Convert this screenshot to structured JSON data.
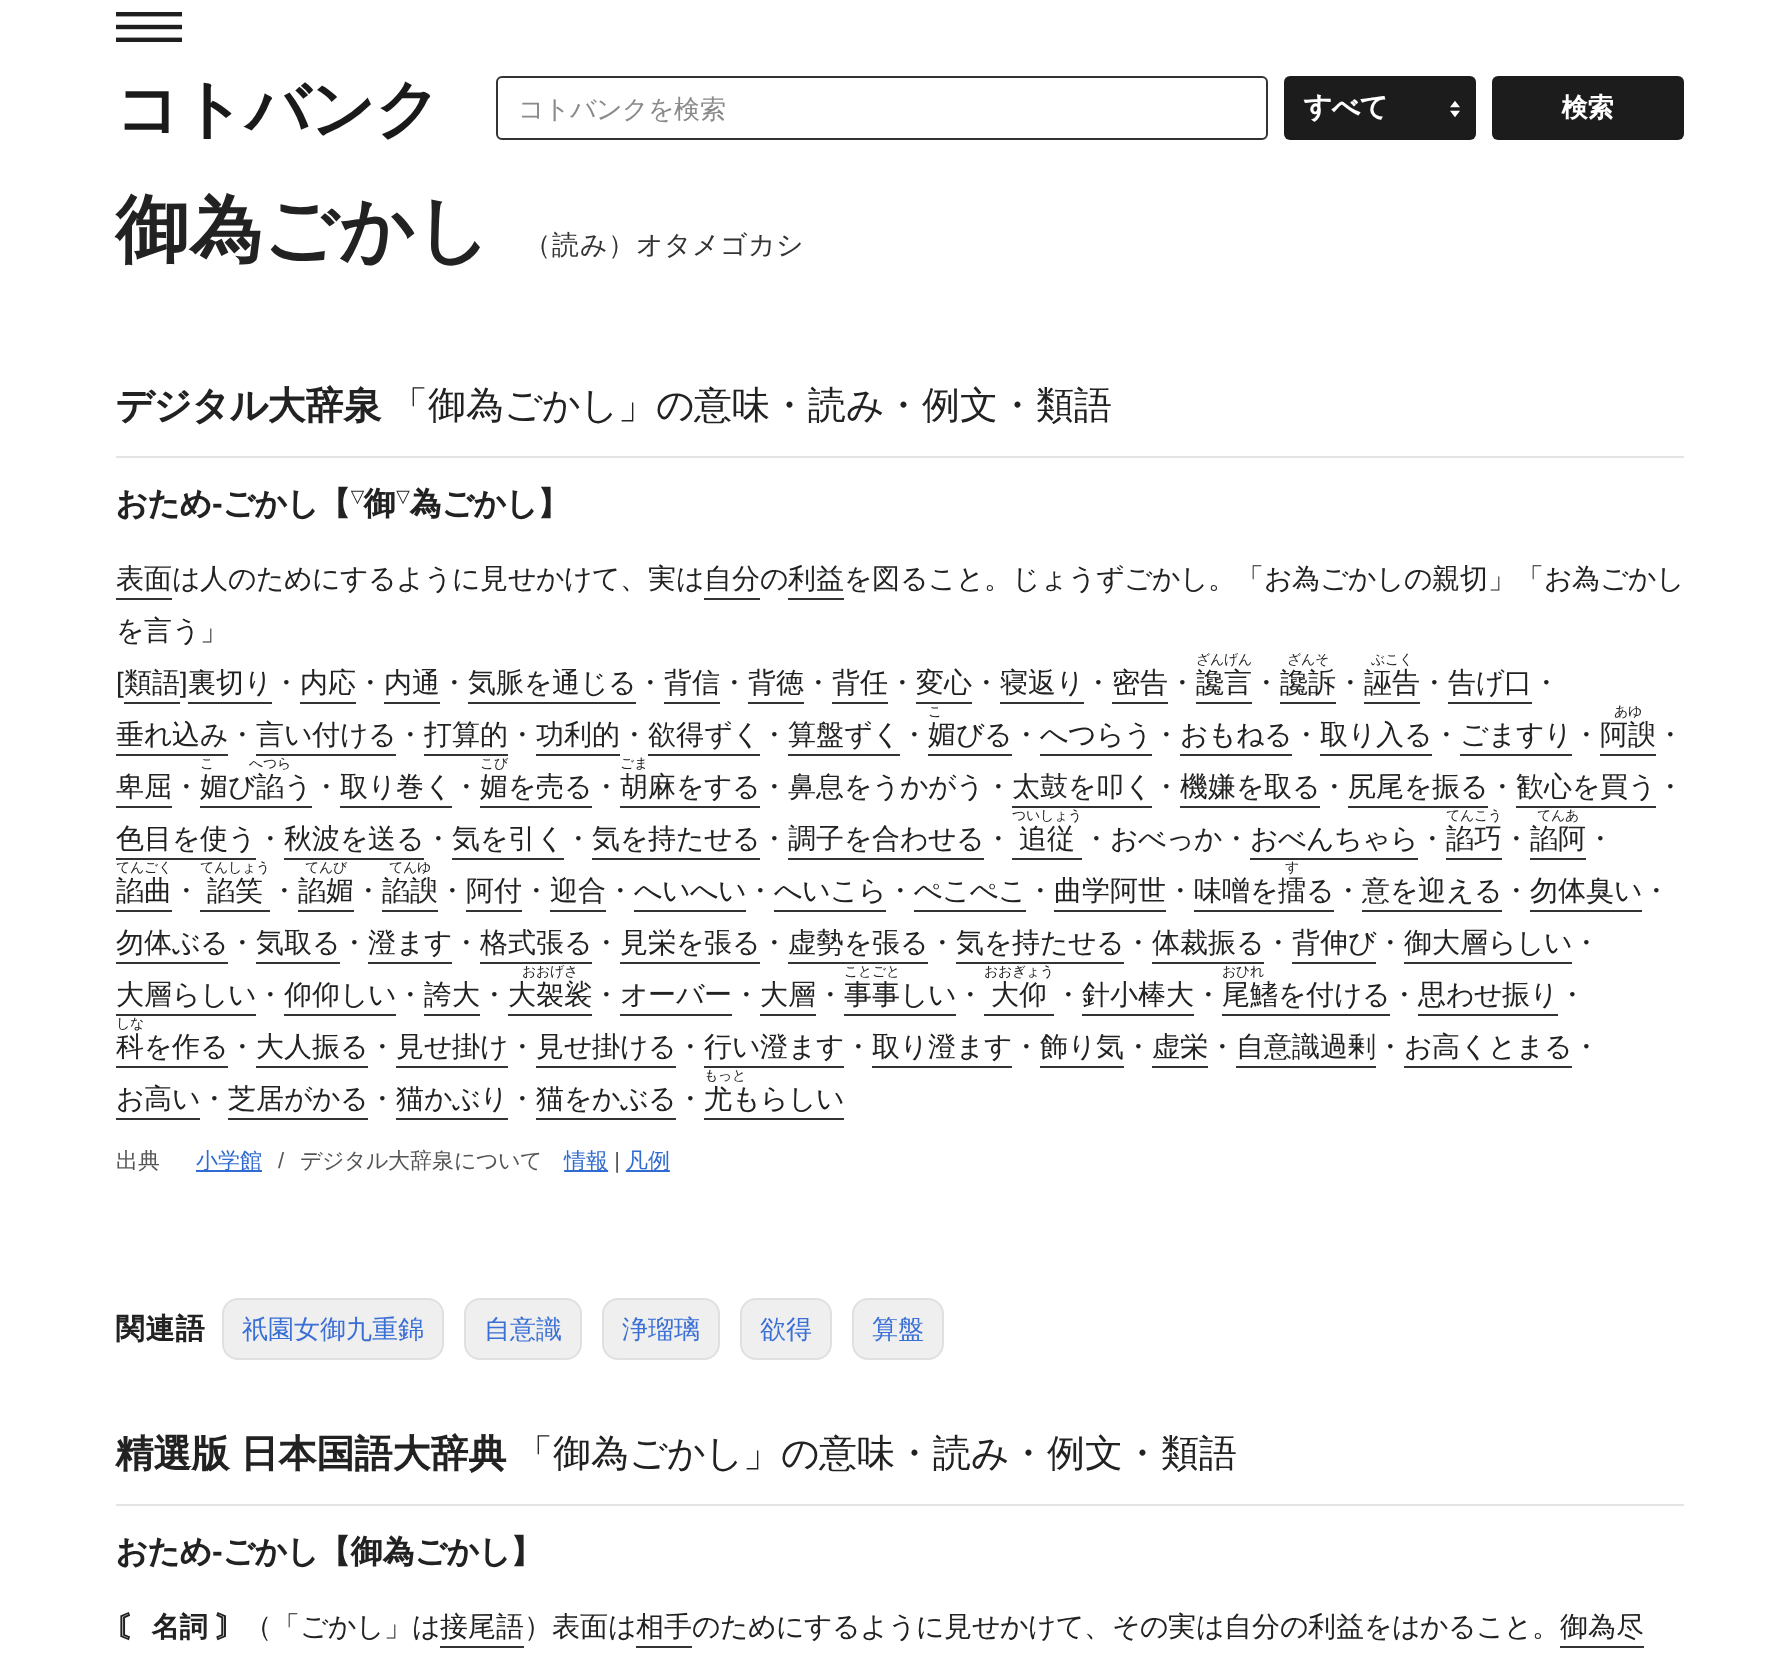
{
  "header": {
    "logo": "コトバンク",
    "search": {
      "placeholder": "コトバンクを検索"
    },
    "scope": "すべて",
    "search_button": "検索"
  },
  "entry": {
    "title": "御為ごかし",
    "reading": "（読み）オタメゴカシ"
  },
  "sections": [
    {
      "kind": "dictionary",
      "name": "デジタル大辞泉",
      "title_rest": "「御為ごかし」の意味・読み・例文・類語",
      "headword": "おため-ごかし【$^{▽}$御$^{▽}$為ごかし】",
      "definition": [
        {
          "kind": "link",
          "text": "表面"
        },
        {
          "kind": "text",
          "text": "は人のためにするように見せかけて、実は"
        },
        {
          "kind": "link",
          "text": "自分"
        },
        {
          "kind": "text",
          "text": "の"
        },
        {
          "kind": "link",
          "text": "利益"
        },
        {
          "kind": "text",
          "text": "を図ること。じょうずごかし。「お為ごかしの親切」「お為ごかしを言う」"
        }
      ],
      "synonyms": {
        "open": "[",
        "label": "類語",
        "close": "]",
        "items": [
          {
            "text": "裏切り",
            "link": true,
            "sep": "・"
          },
          {
            "text": "内応",
            "link": true,
            "sep": "・"
          },
          {
            "text": "内通",
            "link": true,
            "sep": "・"
          },
          {
            "text": "気脈を通じる",
            "link": true,
            "sep": "・"
          },
          {
            "text": "背信",
            "link": true,
            "sep": "・"
          },
          {
            "text": "背徳",
            "link": true,
            "sep": "・"
          },
          {
            "text": "背任",
            "link": true,
            "sep": "・"
          },
          {
            "text": "変心",
            "link": true,
            "sep": "・"
          },
          {
            "text": "寝返り",
            "link": true,
            "sep": "・"
          },
          {
            "text": "密告",
            "link": true,
            "sep": "・"
          },
          {
            "text": "讒言",
            "ruby": "ざんげん",
            "link": true,
            "sep": "・"
          },
          {
            "text": "讒訴",
            "ruby": "ざんそ",
            "link": true,
            "sep": "・"
          },
          {
            "text": "誣告",
            "ruby": "ぶこく",
            "link": true,
            "sep": "・"
          },
          {
            "text": "告げ口",
            "link": true,
            "sep": "・"
          },
          {
            "text": "垂れ込み",
            "link": true,
            "sep": "・"
          },
          {
            "text": "言い付ける",
            "link": true,
            "sep": "・"
          },
          {
            "text": "打算的",
            "link": true,
            "sep": "・"
          },
          {
            "text": "功利的",
            "link": true,
            "sep": "・"
          },
          {
            "text": "欲得ずく",
            "link": true,
            "sep": "・"
          },
          {
            "text": "算盤ずく",
            "link": true,
            "sep": "・"
          },
          {
            "parts": [
              {
                "text": "媚",
                "ruby": "こ"
              },
              {
                "text": "びる"
              }
            ],
            "link": true,
            "sep": "・"
          },
          {
            "text": "へつらう",
            "link": true,
            "sep": "・"
          },
          {
            "text": "おもねる",
            "link": true,
            "sep": "・"
          },
          {
            "text": "取り入る",
            "link": true,
            "sep": "・"
          },
          {
            "text": "ごますり",
            "link": true,
            "sep": "・"
          },
          {
            "text": "阿諛",
            "ruby": "あゆ",
            "link": true,
            "sep": "・"
          },
          {
            "text": "卑屈",
            "link": true,
            "sep": "・"
          },
          {
            "parts": [
              {
                "text": "媚",
                "ruby": "こ"
              },
              {
                "text": "び"
              },
              {
                "text": "諂",
                "ruby": "へつら"
              },
              {
                "text": "う"
              }
            ],
            "link": true,
            "sep": "・"
          },
          {
            "text": "取り巻く",
            "link": true,
            "sep": "・"
          },
          {
            "parts": [
              {
                "text": "媚",
                "ruby": "こび"
              },
              {
                "text": "を売る"
              }
            ],
            "link": true,
            "sep": "・"
          },
          {
            "parts": [
              {
                "text": "胡麻",
                "ruby": "ごま"
              },
              {
                "text": "をする"
              }
            ],
            "link": true,
            "sep": "・"
          },
          {
            "text": "鼻息をうかがう",
            "link": false,
            "sep": "・"
          },
          {
            "text": "太鼓を叩く",
            "link": true,
            "sep": "・"
          },
          {
            "text": "機嫌を取る",
            "link": true,
            "sep": "・"
          },
          {
            "text": "尻尾を振る",
            "link": true,
            "sep": "・"
          },
          {
            "text": "歓心を買う",
            "link": true,
            "sep": "・"
          },
          {
            "text": "色目を使う",
            "link": true,
            "sep": "・"
          },
          {
            "text": "秋波を送る",
            "link": true,
            "sep": "・"
          },
          {
            "text": "気を引く",
            "link": true,
            "sep": "・"
          },
          {
            "text": "気を持たせる",
            "link": true,
            "sep": "・"
          },
          {
            "text": "調子を合わせる",
            "link": true,
            "sep": "・"
          },
          {
            "text": "追従",
            "ruby": "ついしょう",
            "link": true,
            "sep": "・"
          },
          {
            "text": "おべっか",
            "link": false,
            "sep": "・"
          },
          {
            "text": "おべんちゃら",
            "link": true,
            "sep": "・"
          },
          {
            "text": "諂巧",
            "ruby": "てんこう",
            "link": true,
            "sep": "・"
          },
          {
            "text": "諂阿",
            "ruby": "てんあ",
            "link": true,
            "sep": "・"
          },
          {
            "text": "諂曲",
            "ruby": "てんごく",
            "link": true,
            "sep": "・"
          },
          {
            "text": "諂笑",
            "ruby": "てんしょう",
            "link": true,
            "sep": "・"
          },
          {
            "text": "諂媚",
            "ruby": "てんび",
            "link": true,
            "sep": "・"
          },
          {
            "text": "諂諛",
            "ruby": "てんゆ",
            "link": true,
            "sep": "・"
          },
          {
            "text": "阿付",
            "link": true,
            "sep": "・"
          },
          {
            "text": "迎合",
            "link": true,
            "sep": "・"
          },
          {
            "text": "へいへい",
            "link": true,
            "sep": "・"
          },
          {
            "text": "へいこら",
            "link": true,
            "sep": "・"
          },
          {
            "text": "ぺこぺこ",
            "link": true,
            "sep": "・"
          },
          {
            "text": "曲学阿世",
            "link": true,
            "sep": "・"
          },
          {
            "parts": [
              {
                "text": "味噌を"
              },
              {
                "text": "擂",
                "ruby": "す"
              },
              {
                "text": "る"
              }
            ],
            "link": true,
            "sep": "・"
          },
          {
            "text": "意を迎える",
            "link": true,
            "sep": "・"
          },
          {
            "text": "勿体臭い",
            "link": true,
            "sep": "・"
          },
          {
            "text": "勿体ぶる",
            "link": true,
            "sep": "・"
          },
          {
            "text": "気取る",
            "link": true,
            "sep": "・"
          },
          {
            "text": "澄ます",
            "link": true,
            "sep": "・"
          },
          {
            "text": "格式張る",
            "link": true,
            "sep": "・"
          },
          {
            "text": "見栄を張る",
            "link": true,
            "sep": "・"
          },
          {
            "text": "虚勢を張る",
            "link": true,
            "sep": "・"
          },
          {
            "text": "気を持たせる",
            "link": true,
            "sep": "・"
          },
          {
            "text": "体裁振る",
            "link": true,
            "sep": "・"
          },
          {
            "text": "背伸び",
            "link": true,
            "sep": "・"
          },
          {
            "text": "御大層らしい",
            "link": true,
            "sep": "・"
          },
          {
            "text": "大層らしい",
            "link": true,
            "sep": "・"
          },
          {
            "text": "仰仰しい",
            "link": true,
            "sep": "・"
          },
          {
            "text": "誇大",
            "link": true,
            "sep": "・"
          },
          {
            "text": "大袈裟",
            "ruby": "おおげさ",
            "link": true,
            "sep": "・"
          },
          {
            "text": "オーバー",
            "link": true,
            "sep": "・"
          },
          {
            "text": "大層",
            "link": true,
            "sep": "・"
          },
          {
            "parts": [
              {
                "text": "事事",
                "ruby": "ことごと"
              },
              {
                "text": "しい"
              }
            ],
            "link": true,
            "sep": "・"
          },
          {
            "text": "大仰",
            "ruby": "おおぎょう",
            "link": true,
            "sep": "・"
          },
          {
            "text": "針小棒大",
            "link": true,
            "sep": "・"
          },
          {
            "parts": [
              {
                "text": "尾鰭",
                "ruby": "おひれ"
              },
              {
                "text": "を付ける"
              }
            ],
            "link": true,
            "sep": "・"
          },
          {
            "text": "思わせ振り",
            "link": true,
            "sep": "・"
          },
          {
            "parts": [
              {
                "text": "科",
                "ruby": "しな"
              },
              {
                "text": "を作る"
              }
            ],
            "link": true,
            "sep": "・"
          },
          {
            "text": "大人振る",
            "link": true,
            "sep": "・"
          },
          {
            "text": "見せ掛け",
            "link": true,
            "sep": "・"
          },
          {
            "text": "見せ掛ける",
            "link": true,
            "sep": "・"
          },
          {
            "text": "行い澄ます",
            "link": true,
            "sep": "・"
          },
          {
            "text": "取り澄ます",
            "link": true,
            "sep": "・"
          },
          {
            "text": "飾り気",
            "link": true,
            "sep": "・"
          },
          {
            "text": "虚栄",
            "link": true,
            "sep": "・"
          },
          {
            "text": "自意識過剰",
            "link": true,
            "sep": "・"
          },
          {
            "text": "お高くとまる",
            "link": true,
            "sep": "・"
          },
          {
            "text": "お高い",
            "link": true,
            "sep": "・"
          },
          {
            "text": "芝居がかる",
            "link": true,
            "sep": "・"
          },
          {
            "text": "猫かぶり",
            "link": true,
            "sep": "・"
          },
          {
            "text": "猫をかぶる",
            "link": true,
            "sep": "・"
          },
          {
            "parts": [
              {
                "text": "尤",
                "ruby": "もっと"
              },
              {
                "text": "もらしい"
              }
            ],
            "link": true
          }
        ]
      },
      "source": {
        "label": "出典",
        "publisher": "小学館",
        "slash": "/",
        "about": "デジタル大辞泉について",
        "links": [
          {
            "text": "情報",
            "sep": "|"
          },
          {
            "text": "凡例"
          }
        ]
      }
    },
    {
      "kind": "related",
      "label": "関連語",
      "terms": [
        "祇園女御九重錦",
        "自意識",
        "浄瑠璃",
        "欲得",
        "算盤"
      ]
    },
    {
      "kind": "dictionary",
      "name": "精選版 日本国語大辞典",
      "title_rest": "「御為ごかし」の意味・読み・例文・類語",
      "headword": "おため-ごかし【御為ごかし】",
      "definition": [
        {
          "kind": "label",
          "text": "〘 名詞 〙"
        },
        {
          "kind": "text",
          "text": "（「ごかし」は"
        },
        {
          "kind": "link",
          "text": "接尾語"
        },
        {
          "kind": "text",
          "text": "）表面は"
        },
        {
          "kind": "link",
          "text": "相手"
        },
        {
          "kind": "text",
          "text": "のためにするように見せかけて、その実は自分の利益をはかること。"
        },
        {
          "kind": "link",
          "text": "御為尽"
        }
      ]
    }
  ]
}
